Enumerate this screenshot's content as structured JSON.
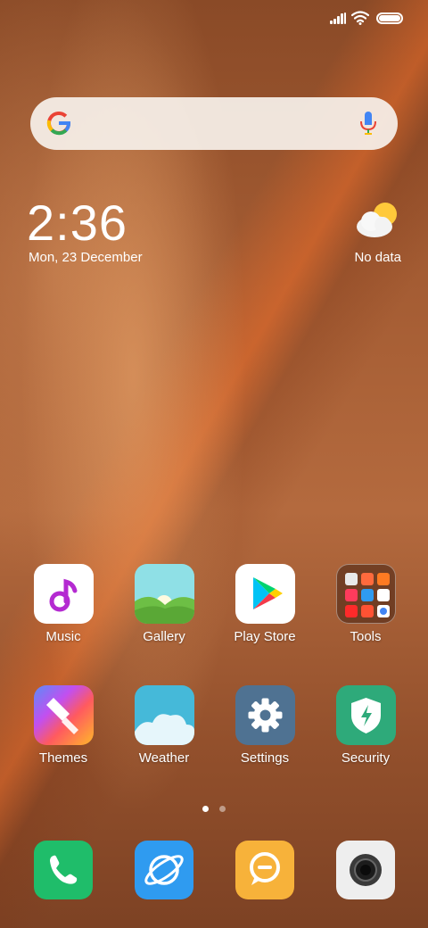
{
  "status_bar": {
    "icons": [
      "signal-icon",
      "wifi-icon",
      "battery-icon"
    ]
  },
  "search_bar": {
    "logo": "google-logo",
    "mic": "mic-icon"
  },
  "clock": {
    "time": "2:36",
    "date": "Mon, 23 December"
  },
  "weather": {
    "icon": "partly-cloudy-icon",
    "text": "No data"
  },
  "apps": {
    "row1": [
      {
        "label": "Music",
        "icon": "music-icon"
      },
      {
        "label": "Gallery",
        "icon": "gallery-icon"
      },
      {
        "label": "Play Store",
        "icon": "play-store-icon"
      },
      {
        "label": "Tools",
        "icon": "folder-icon"
      }
    ],
    "row2": [
      {
        "label": "Themes",
        "icon": "themes-icon"
      },
      {
        "label": "Weather",
        "icon": "weather-app-icon"
      },
      {
        "label": "Settings",
        "icon": "settings-icon"
      },
      {
        "label": "Security",
        "icon": "security-icon"
      }
    ]
  },
  "page_indicator": {
    "pages": 2,
    "active": 1
  },
  "dock": [
    {
      "name": "phone",
      "icon": "phone-icon"
    },
    {
      "name": "browser",
      "icon": "browser-icon"
    },
    {
      "name": "messaging",
      "icon": "messaging-icon"
    },
    {
      "name": "camera",
      "icon": "camera-icon"
    }
  ],
  "colors": {
    "music": "#ffffff",
    "gallery_sky": "#8fe0e6",
    "gallery_hill": "#6dbf45",
    "settings": "#4f7292",
    "security": "#2eaa7a",
    "weather_app": "#45b9d9",
    "phone": "#1fbd6a",
    "browser": "#2f9bf0",
    "messaging": "#f7b23a",
    "camera": "#eeeeee"
  }
}
